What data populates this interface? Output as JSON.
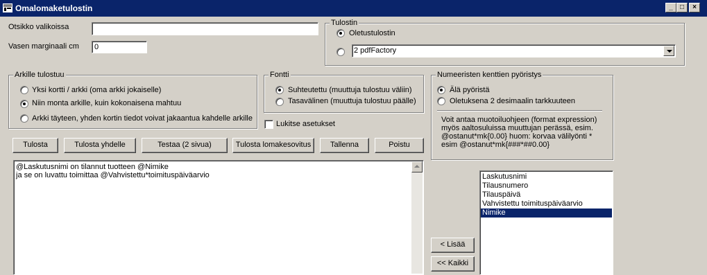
{
  "window": {
    "title": "Omalomaketulostin",
    "controls": [
      "_",
      "□",
      "×"
    ]
  },
  "form": {
    "otsikko_label": "Otsikko valikoissa",
    "otsikko_value": "",
    "marginaali_label": "Vasen marginaali cm",
    "marginaali_value": "0"
  },
  "tulostin": {
    "title": "Tulostin",
    "default_label": "Oletustulostin",
    "selected_printer": "2 pdfFactory"
  },
  "arkille": {
    "title": "Arkille tulostuu",
    "options": [
      "Yksi kortti / arkki (oma arkki jokaiselle)",
      "Niin monta arkille, kuin kokonaisena mahtuu",
      "Arkki täyteen, yhden kortin tiedot voivat jakaantua kahdelle arkille"
    ]
  },
  "fontti": {
    "title": "Fontti",
    "options": [
      "Suhteutettu (muuttuja tulostuu väliin)",
      "Tasavälinen (muuttuja tulostuu päälle)"
    ]
  },
  "lukitse": {
    "label": "Lukitse asetukset"
  },
  "pyoristys": {
    "title": "Numeeristen kenttien pyöristys",
    "options": [
      "Älä pyöristä",
      "Oletuksena 2 desimaalin tarkkuuteen"
    ],
    "help_lines": [
      "Voit antaa muotoiluohjeen (format expression)",
      "myös aaltosuluissa muuttujan perässä, esim.",
      "@ostanut*mk{0.00} huom: korvaa välilyönti  *",
      "esim @ostanut*mk{###*##0.00}"
    ]
  },
  "buttons": {
    "tulosta": "Tulosta",
    "tulosta_yhdelle": "Tulosta yhdelle",
    "testaa": "Testaa (2 sivua)",
    "tulosta_lomake": "Tulosta lomakesovitus",
    "tallenna": "Tallenna",
    "poistu": "Poistu",
    "lisaa": "< Lisää",
    "kaikki": "<< Kaikki"
  },
  "editor": {
    "lines": [
      "@Laskutusnimi on tilannut tuotteen @Nimike",
      "ja se on luvattu toimittaa @Vahvistettu*toimituspäiväarvio"
    ]
  },
  "fields_list": {
    "items": [
      "Laskutusnimi",
      "Tilausnumero",
      "Tilauspäivä",
      "Vahvistettu toimituspäiväarvio",
      "Nimike"
    ],
    "selected": "Nimike"
  },
  "colors": {
    "face": "#d4d0c8",
    "titlebar": "#0a246a",
    "selection": "#0a246a"
  }
}
